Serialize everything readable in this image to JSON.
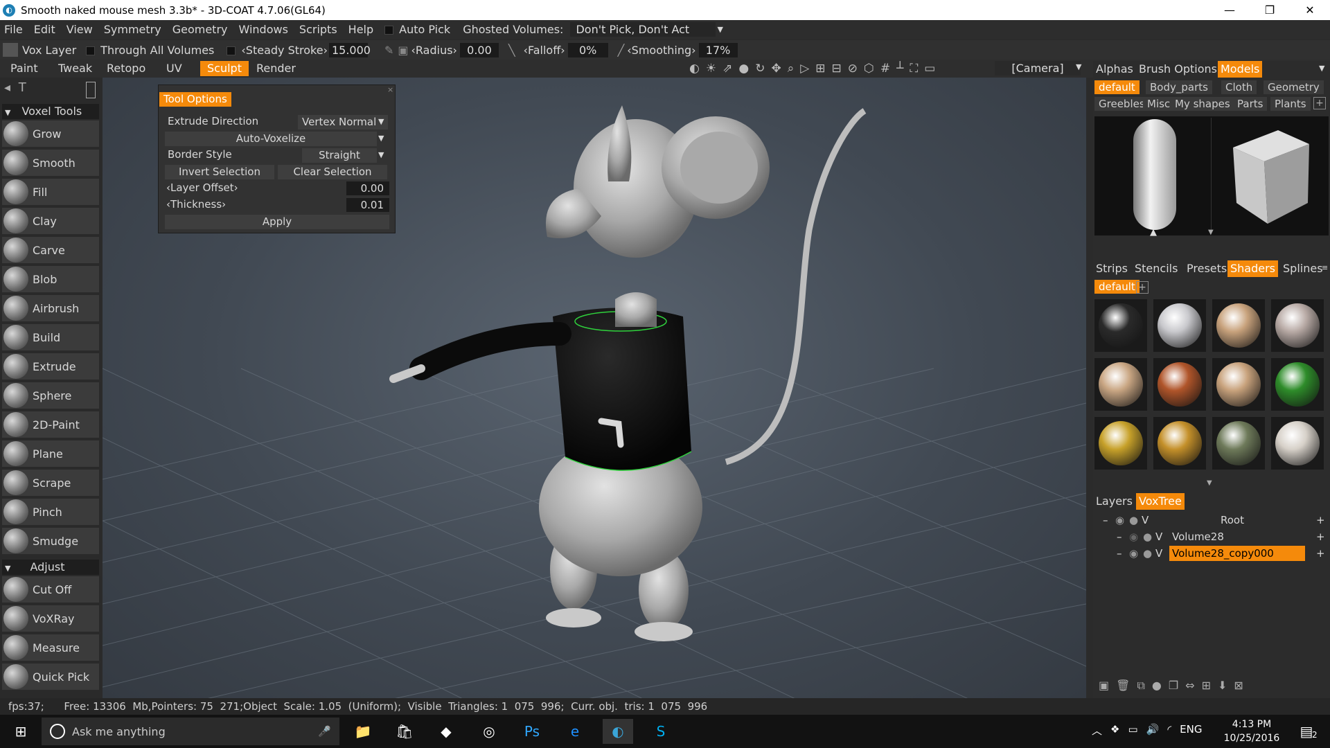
{
  "window": {
    "title": "Smooth naked mouse mesh 3.3b* - 3D-COAT 4.7.06(GL64)"
  },
  "menu": {
    "items": [
      "File",
      "Edit",
      "View",
      "Symmetry",
      "Geometry",
      "Windows",
      "Scripts",
      "Help"
    ],
    "auto_pick": "Auto Pick",
    "ghosted_label": "Ghosted Volumes:",
    "ghosted_value": "Don't Pick, Don't Act"
  },
  "toolbar": {
    "vox_layer": "Vox Layer",
    "through_all": "Through  All  Volumes",
    "steady_label": "‹Steady  Stroke›",
    "steady_value": "15.000",
    "radius_label": "‹Radius›",
    "radius_value": "0.00",
    "falloff_label": "‹Falloff›",
    "falloff_value": "0%",
    "smoothing_label": "‹Smoothing›",
    "smoothing_value": "17%"
  },
  "rooms": {
    "items": [
      "Paint",
      "Tweak",
      "Retopo",
      "UV",
      "Sculpt",
      "Render"
    ],
    "active": "Sculpt",
    "camera": "[Camera]"
  },
  "tools": {
    "section": "Voxel  Tools",
    "items": [
      "Grow",
      "Smooth",
      "Fill",
      "Clay",
      "Carve",
      "Blob",
      "Airbrush",
      "Build",
      "Extrude",
      "Sphere",
      "2D-Paint",
      "Plane",
      "Scrape",
      "Pinch",
      "Smudge"
    ],
    "adjust_section": "Adjust",
    "adjust_items": [
      "Cut Off",
      "VoXRay",
      "Measure",
      "Quick Pick"
    ]
  },
  "tool_options": {
    "title": "Tool Options",
    "extrude_label": "Extrude Direction",
    "extrude_value": "Vertex Normal",
    "auto_voxelize": "Auto-Voxelize",
    "border_label": "Border Style",
    "border_value": "Straight",
    "invert": "Invert Selection",
    "clear": "Clear Selection",
    "layer_offset_label": "‹Layer Offset›",
    "layer_offset_value": "0.00",
    "thickness_label": "‹Thickness›",
    "thickness_value": "0.01",
    "apply": "Apply"
  },
  "right": {
    "top_tabs": [
      "Alphas",
      "Brush  Options",
      "Models"
    ],
    "top_active": "Models",
    "model_cats_1": [
      "default",
      "Body_parts",
      "Cloth",
      "Geometry"
    ],
    "model_cats_2": [
      "Greebles",
      "Misc",
      "My  shapes",
      "Parts",
      "Plants"
    ],
    "mid_tabs": [
      "Strips",
      "Stencils",
      "Presets",
      "Shaders",
      "Splines"
    ],
    "mid_active": "Shaders",
    "shader_preset": "default",
    "shader_colors": [
      "#2a2a2a",
      "#c9c9cd",
      "#c8a27c",
      "#b8aaa5",
      "#c9a683",
      "#b0552a",
      "#c8a27c",
      "#2e8c2a",
      "#c7a12a",
      "#c4902a",
      "#6e7a5a",
      "#d6d0c8"
    ],
    "layer_tabs": [
      "Layers",
      "VoxTree"
    ],
    "layer_active": "VoxTree",
    "layers": [
      "Root",
      "Volume28",
      "Volume28_copy000"
    ]
  },
  "status": {
    "text": "fps:37;      Free: 13306  Mb,Pointers: 75  271;Object  Scale: 1.05  (Uniform);  Visible  Triangles: 1  075  996;  Curr. obj.  tris: 1  075  996"
  },
  "taskbar": {
    "search": "Ask me anything",
    "lang": "ENG",
    "time": "4:13 PM",
    "date": "10/25/2016",
    "notif": "2"
  }
}
